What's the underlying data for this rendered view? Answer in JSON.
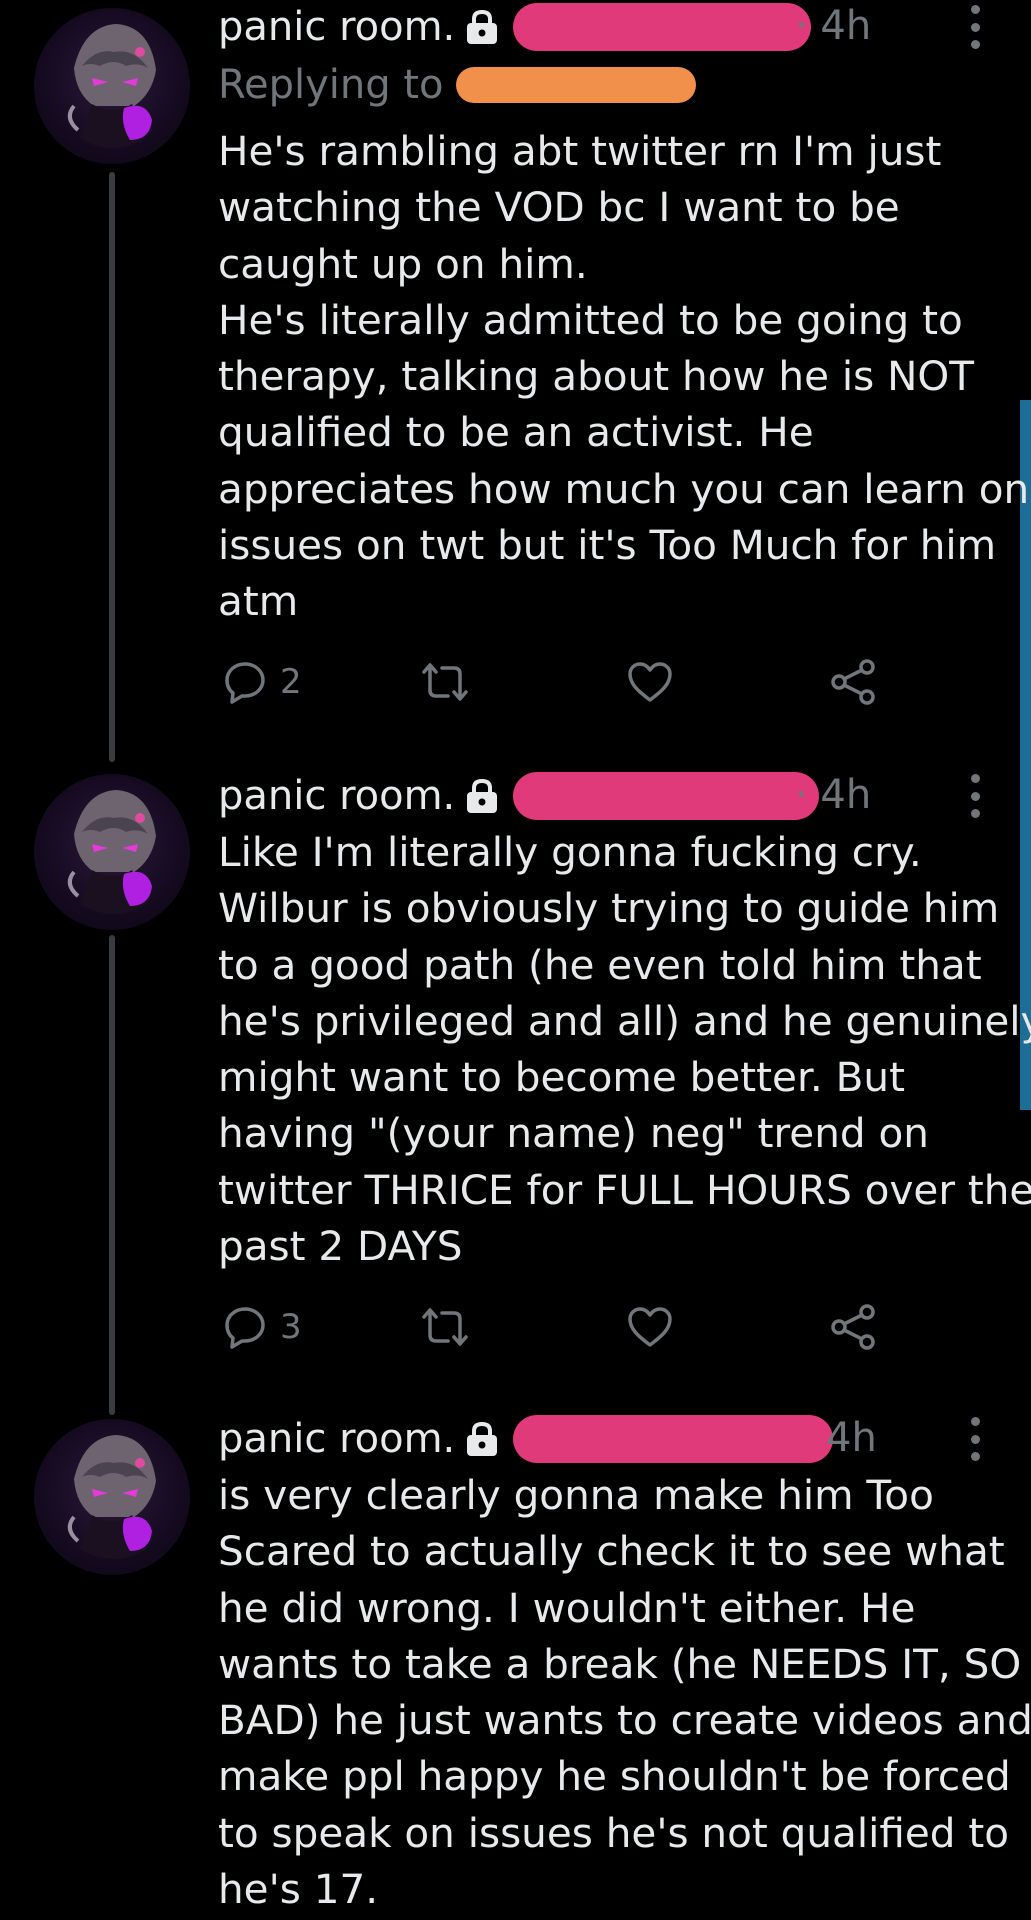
{
  "tweets": [
    {
      "display_name": "panic room.",
      "timestamp": "· 4h",
      "replying_to": "Replying to",
      "lines": [
        "He's rambling abt twitter rn I'm just",
        "watching the VOD bc I want to be",
        "caught up on him.",
        "He's literally admitted to be going to",
        "therapy, talking about how he is NOT",
        "qualified to be an activist. He",
        "appreciates how much you can learn on",
        "issues on twt but it's Too Much for him",
        "atm"
      ],
      "reply_count": "2"
    },
    {
      "display_name": "panic room.",
      "timestamp": "· 4h",
      "lines": [
        "Like I'm literally gonna fucking cry.",
        "Wilbur is obviously trying to guide him",
        "to a good path (he even told him that",
        "he's privileged and all) and he genuinely",
        "might want to become better. But",
        "having \"(your name) neg\" trend on",
        "twitter THRICE for FULL HOURS over the",
        "past 2 DAYS"
      ],
      "reply_count": "3"
    },
    {
      "display_name": "panic room.",
      "timestamp": "4h",
      "lines": [
        "is very clearly gonna make him Too",
        "Scared to actually check it to see what",
        "he did wrong. I wouldn't either. He",
        "wants to take a break (he NEEDS IT, SO",
        "BAD) he just wants to create videos and",
        "make ppl happy he shouldn't be forced",
        "to speak on issues he's not qualified to",
        "he's 17."
      ]
    }
  ],
  "colors": {
    "background": "#000000",
    "text_primary": "#e7e9ea",
    "text_secondary": "#71767b",
    "redaction_pink": "#e03a7a",
    "redaction_orange": "#f0904a",
    "thread_line": "#3a3d40",
    "scroll_indicator": "#1d6e96",
    "avatar_accent": "#b020e0"
  },
  "icons": {
    "lock": "lock-icon",
    "more": "more-vertical-icon",
    "reply": "reply-bubble-icon",
    "retweet": "retweet-icon",
    "like": "heart-icon",
    "share": "share-icon"
  }
}
